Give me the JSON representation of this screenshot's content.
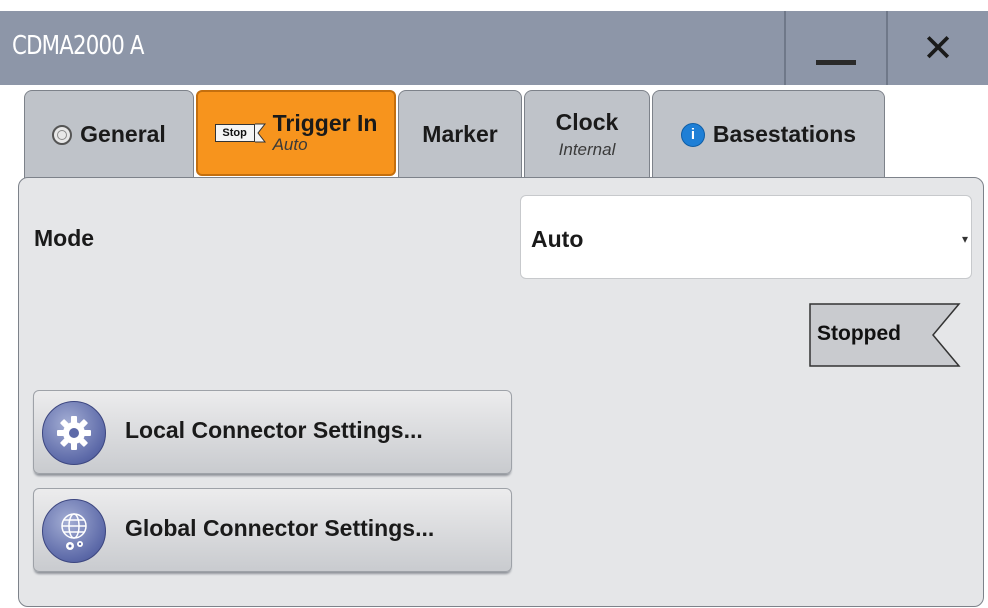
{
  "window": {
    "title": "CDMA2000 A",
    "minimize_icon": "minimize-icon",
    "close_icon": "close-icon"
  },
  "tabs": [
    {
      "label": "General",
      "icon": "radio-off-icon"
    },
    {
      "label": "Trigger In",
      "sub": "Auto",
      "icon": "stop-indicator-icon",
      "icon_text": "Stop",
      "active": true
    },
    {
      "label": "Marker"
    },
    {
      "label": "Clock",
      "sub": "Internal"
    },
    {
      "label": "Basestations",
      "icon": "info-icon",
      "icon_text": "i"
    }
  ],
  "trigger": {
    "mode_label": "Mode",
    "mode_value": "Auto",
    "status": "Stopped"
  },
  "buttons": {
    "local": "Local Connector Settings...",
    "global": "Global Connector Settings..."
  },
  "colors": {
    "titlebar": "#8d96a8",
    "active_tab": "#f7941d",
    "tab": "#bfc3c9",
    "panel": "#e5e6e8",
    "button_icon": "#5c69a8"
  }
}
